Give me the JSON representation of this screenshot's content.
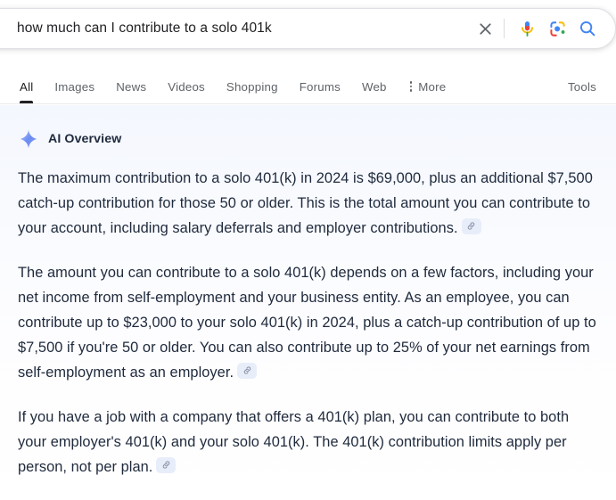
{
  "search": {
    "query": "how much can I contribute to a solo 401k",
    "placeholder": "Search",
    "clear_icon": "close-icon",
    "voice_icon": "microphone-icon",
    "lens_icon": "google-lens-icon",
    "search_icon": "search-icon"
  },
  "tabs": {
    "items": [
      {
        "label": "All",
        "active": true
      },
      {
        "label": "Images",
        "active": false
      },
      {
        "label": "News",
        "active": false
      },
      {
        "label": "Videos",
        "active": false
      },
      {
        "label": "Shopping",
        "active": false
      },
      {
        "label": "Forums",
        "active": false
      },
      {
        "label": "Web",
        "active": false
      }
    ],
    "more_label": "More",
    "more_icon": "kebab-menu-icon",
    "tools_label": "Tools"
  },
  "ai_overview": {
    "title": "AI Overview",
    "sparkle_icon": "sparkle-icon",
    "citation_icon": "link-icon",
    "paragraphs": [
      "The maximum contribution to a solo 401(k) in 2024 is $69,000, plus an additional $7,500 catch-up contribution for those 50 or older. This is the total amount you can contribute to your account, including salary deferrals and employer contributions.",
      "The amount you can contribute to a solo 401(k) depends on a few factors, including your net income from self-employment and your business entity. As an employee, you can contribute up to $23,000 to your solo 401(k) in 2024, plus a catch-up contribution of up to $7,500 if you're 50 or older. You can also contribute up to 25% of your net earnings from self-employment as an employer.",
      "If you have a job with a company that offers a 401(k) plan, you can contribute to both your employer's 401(k) and your solo 401(k). The 401(k) contribution limits apply per person, not per plan."
    ]
  },
  "colors": {
    "text_primary": "#202124",
    "text_secondary": "#5f6368",
    "ai_text": "#1f2a3c",
    "accent_blue": "#4285f4",
    "chip_bg": "#e8edfa"
  }
}
